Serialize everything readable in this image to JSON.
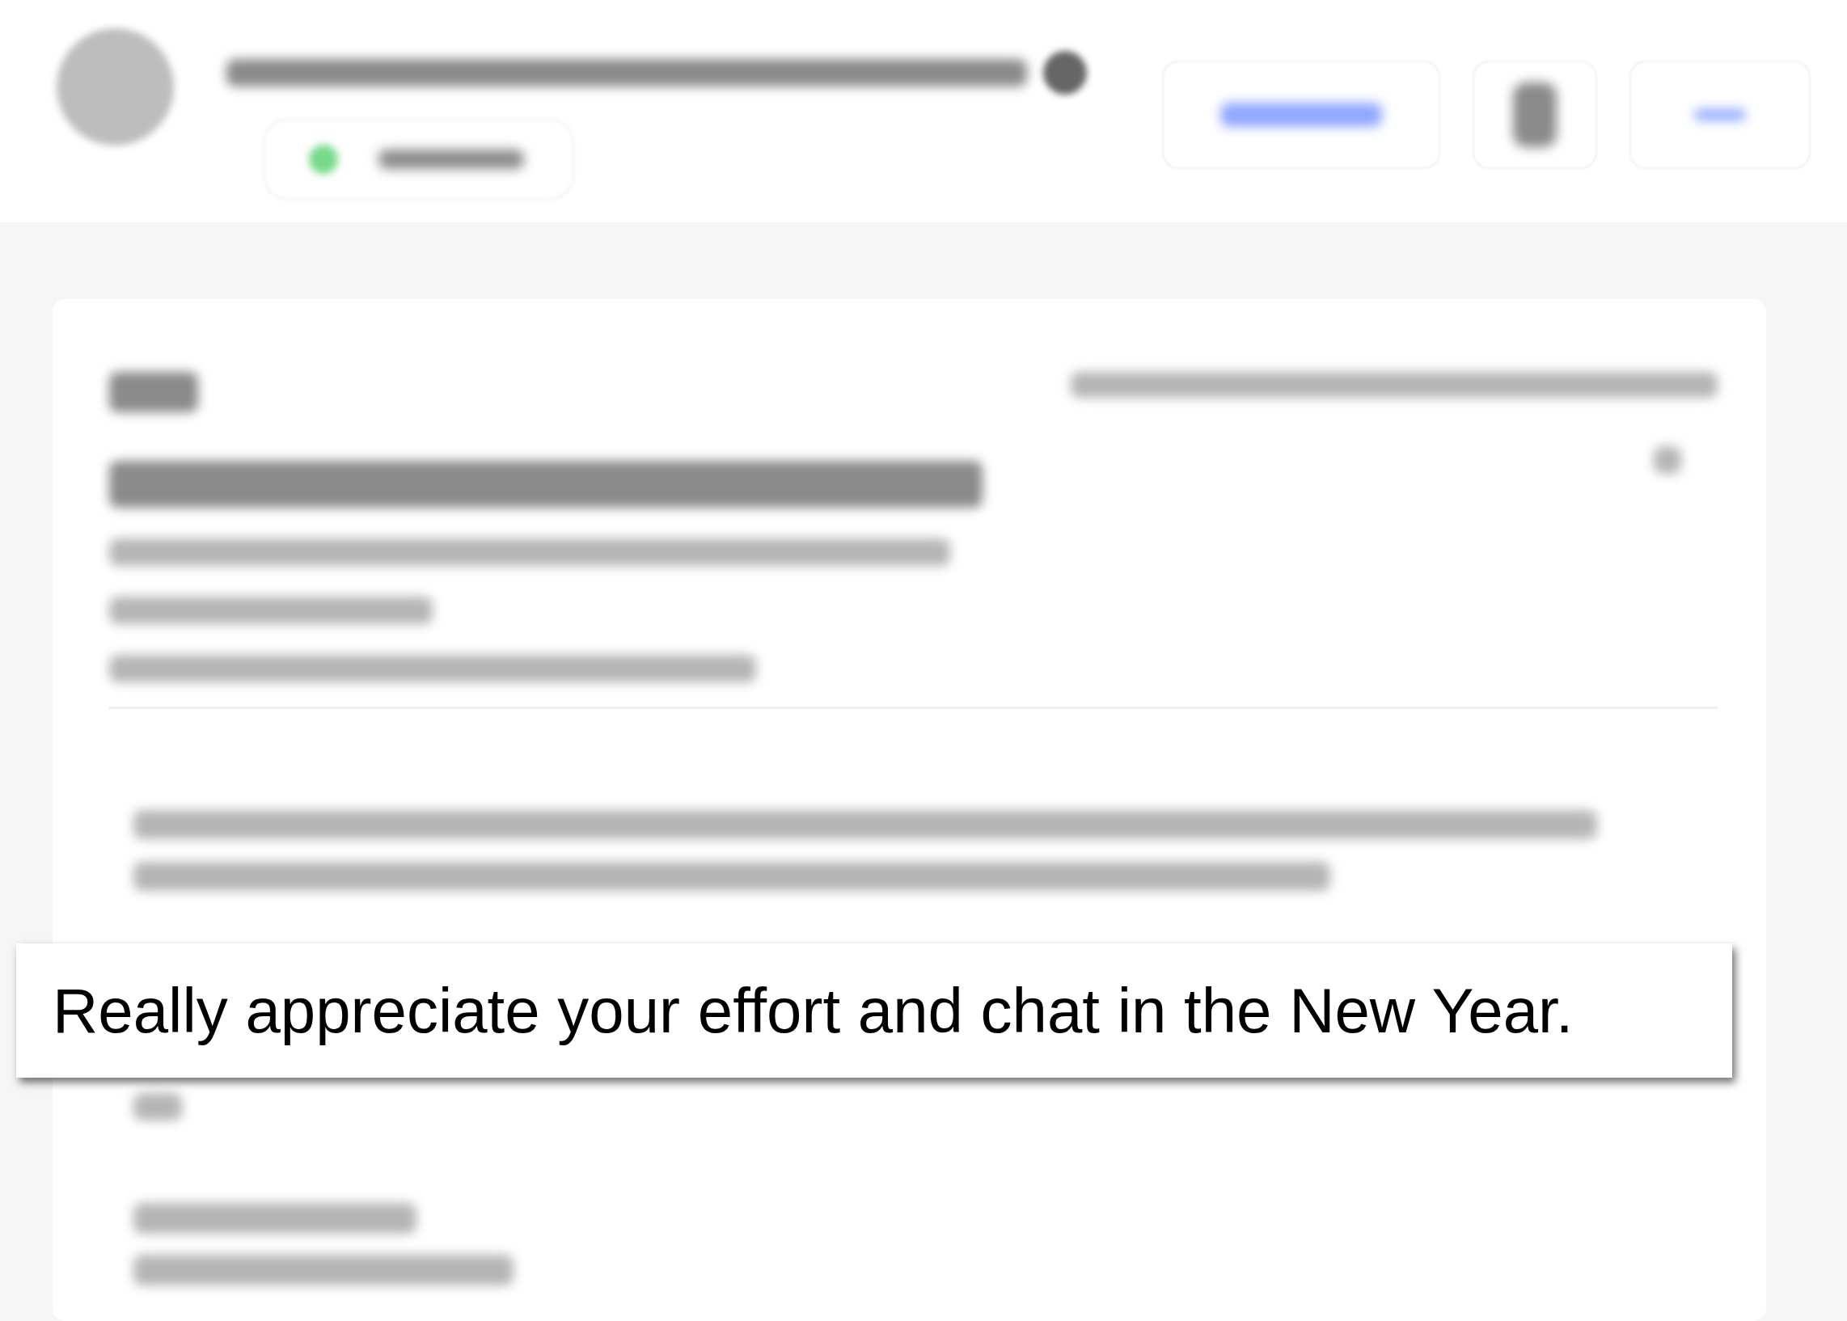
{
  "callout": {
    "text": "Really appreciate your effort and chat in the New Year."
  }
}
